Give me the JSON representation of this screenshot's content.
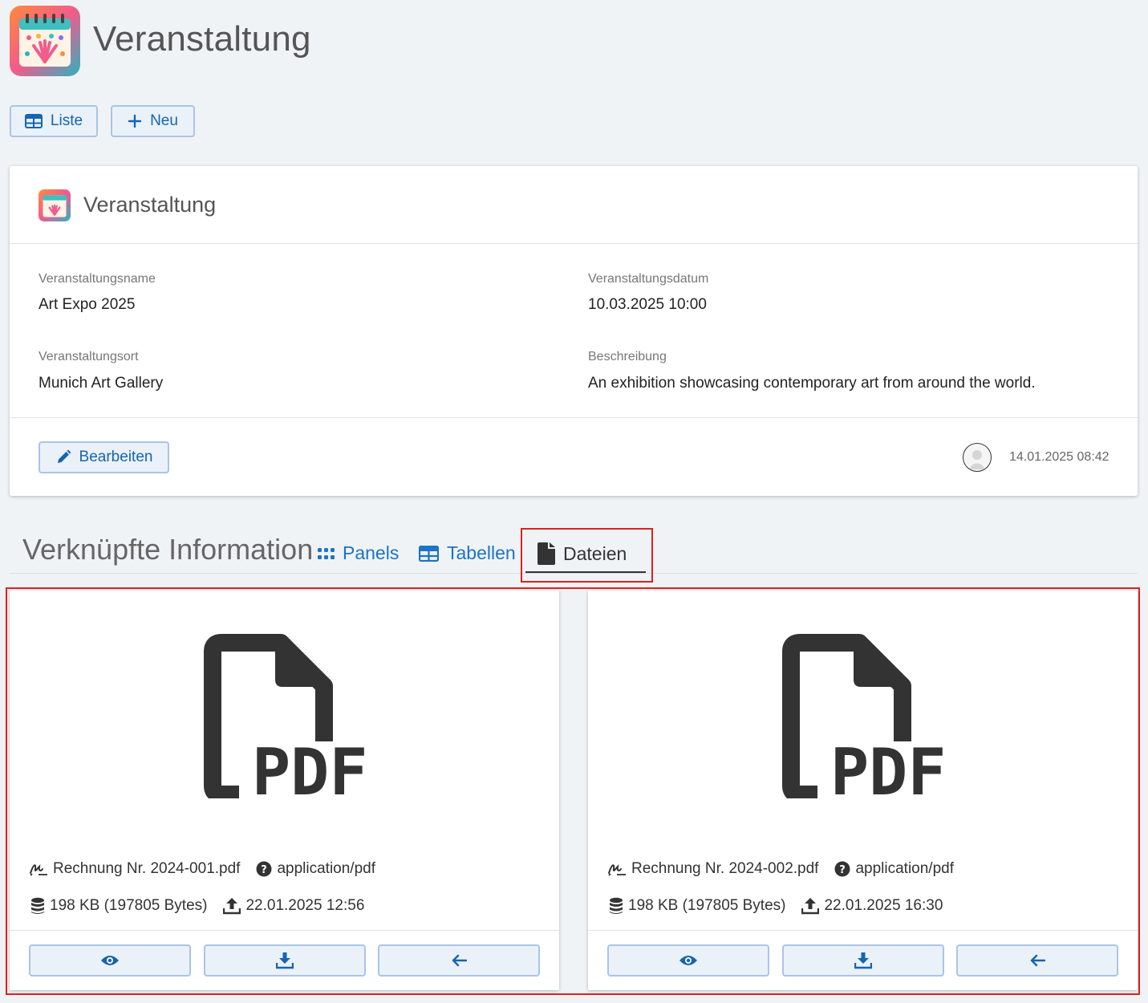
{
  "header": {
    "title": "Veranstaltung",
    "list_button": "Liste",
    "new_button": "Neu"
  },
  "record": {
    "title": "Veranstaltung",
    "fields": {
      "name_label": "Veranstaltungsname",
      "name_value": "Art Expo 2025",
      "date_label": "Veranstaltungsdatum",
      "date_value": "10.03.2025 10:00",
      "location_label": "Veranstaltungsort",
      "location_value": "Munich Art Gallery",
      "description_label": "Beschreibung",
      "description_value": "An exhibition showcasing contemporary art from around the world."
    },
    "edit_button": "Bearbeiten",
    "modified": "14.01.2025 08:42"
  },
  "related": {
    "title": "Verknüpfte Information",
    "tabs": [
      {
        "label": "Panels",
        "icon": "grid-dots-icon",
        "active": false
      },
      {
        "label": "Tabellen",
        "icon": "table-icon",
        "active": false
      },
      {
        "label": "Dateien",
        "icon": "file-icon",
        "active": true
      }
    ]
  },
  "files": [
    {
      "name": "Rechnung Nr. 2024-001.pdf",
      "mime": "application/pdf",
      "size": "198 KB (197805 Bytes)",
      "uploaded": "22.01.2025 12:56",
      "preview_label": "PDF"
    },
    {
      "name": "Rechnung Nr. 2024-002.pdf",
      "mime": "application/pdf",
      "size": "198 KB (197805 Bytes)",
      "uploaded": "22.01.2025 16:30",
      "preview_label": "PDF"
    }
  ],
  "colors": {
    "accent": "#1b74c5",
    "button_border": "#a9c5e6",
    "highlight": "#e02020",
    "page_bg": "#f0f3f6"
  }
}
